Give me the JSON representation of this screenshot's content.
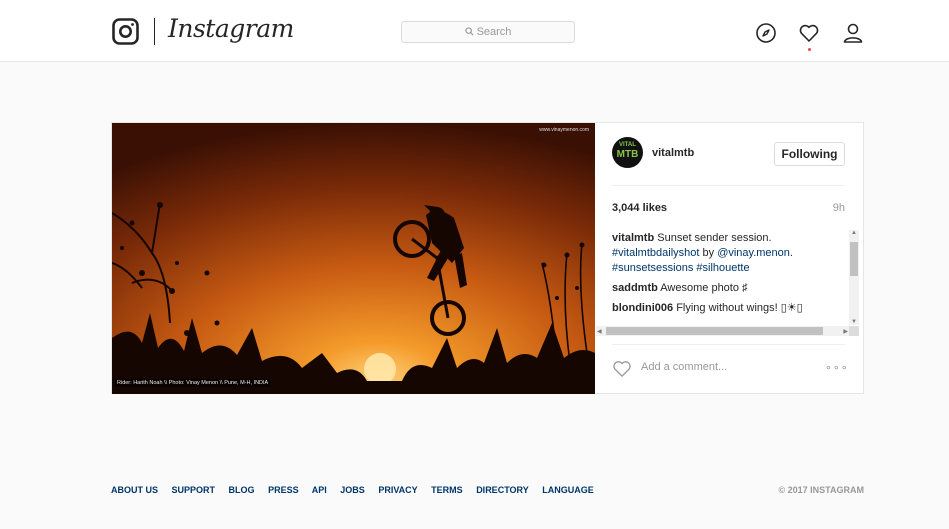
{
  "header": {
    "brand": "Instagram",
    "search_placeholder": "Search"
  },
  "post": {
    "watermark": "www.vinaymenon.com",
    "photo_credit": "Rider: Harith Noah \\\\ Photo: Vinay Menon \\\\ Pune, M-H, INDIA",
    "avatar_text_top": "VITAL",
    "avatar_text_bottom": "MTB",
    "username": "vitalmtb",
    "follow_label": "Following",
    "likes": "3,044 likes",
    "time": "9h",
    "caption": {
      "user": "vitalmtb",
      "text": "Sunset sender session.",
      "tag1": "#vitalmtbdailyshot",
      "by": "by",
      "mention": "@vinay.menon",
      "tag2": "#sunsetsessions",
      "tag3": "#silhouette"
    },
    "comments": [
      {
        "user": "saddmtb",
        "text": "Awesome photo ♯"
      },
      {
        "user": "blondini006",
        "text": "Flying without wings! ▯☀▯"
      }
    ],
    "add_comment_placeholder": "Add a comment...",
    "more": "∘∘∘"
  },
  "footer": {
    "links": [
      "ABOUT US",
      "SUPPORT",
      "BLOG",
      "PRESS",
      "API",
      "JOBS",
      "PRIVACY",
      "TERMS",
      "DIRECTORY",
      "LANGUAGE"
    ],
    "copyright": "© 2017 INSTAGRAM"
  },
  "colors": {
    "link": "#003569",
    "notification_dot": "#ed4956"
  }
}
